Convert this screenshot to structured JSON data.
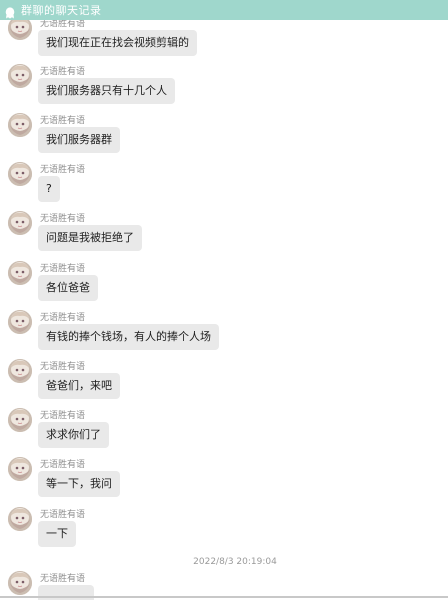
{
  "window": {
    "title": "群聊的聊天记录",
    "titlebar_color": "#9fd7cc"
  },
  "messages": [
    {
      "sender": "无语胜有语",
      "text": "我们现在正在找会视频剪辑的"
    },
    {
      "sender": "无语胜有语",
      "text": "我们服务器只有十几个人"
    },
    {
      "sender": "无语胜有语",
      "text": "我们服务器群"
    },
    {
      "sender": "无语胜有语",
      "text": "?"
    },
    {
      "sender": "无语胜有语",
      "text": "问题是我被拒绝了"
    },
    {
      "sender": "无语胜有语",
      "text": "各位爸爸"
    },
    {
      "sender": "无语胜有语",
      "text": "有钱的捧个钱场，有人的捧个人场"
    },
    {
      "sender": "无语胜有语",
      "text": "爸爸们，来吧"
    },
    {
      "sender": "无语胜有语",
      "text": "求求你们了"
    },
    {
      "sender": "无语胜有语",
      "text": "等一下，我问"
    },
    {
      "sender": "无语胜有语",
      "text": "一下"
    },
    {
      "sender": "无语胜有语",
      "text": ""
    }
  ],
  "timestamp": "2022/8/3 20:19:04",
  "colors": {
    "bubble": "#e9e9e9",
    "sender": "#8f8f8f"
  }
}
